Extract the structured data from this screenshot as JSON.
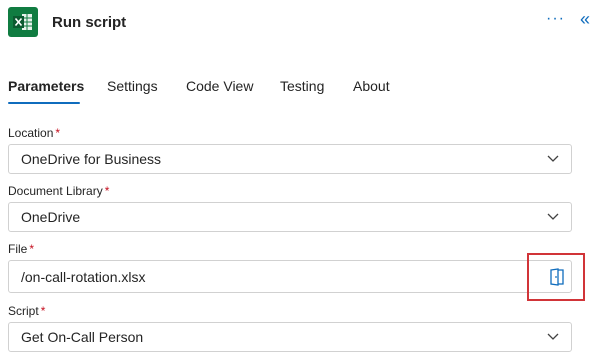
{
  "header": {
    "title": "Run script",
    "more_icon": "ellipsis-icon",
    "collapse_icon": "double-chevron-left-icon",
    "accent": "#0f6cbd"
  },
  "tabs": [
    {
      "label": "Parameters"
    },
    {
      "label": "Settings"
    },
    {
      "label": "Code View"
    },
    {
      "label": "Testing"
    },
    {
      "label": "About"
    }
  ],
  "fields": {
    "location": {
      "label": "Location",
      "required": "*",
      "value": "OneDrive for Business"
    },
    "document_library": {
      "label": "Document Library",
      "required": "*",
      "value": "OneDrive"
    },
    "file": {
      "label": "File",
      "required": "*",
      "value": "/on-call-rotation.xlsx"
    },
    "script": {
      "label": "Script",
      "required": "*",
      "value": "Get On-Call Person"
    }
  },
  "colors": {
    "excel_green": "#107c41",
    "required": "#c50f1f",
    "highlight": "#d13438"
  }
}
